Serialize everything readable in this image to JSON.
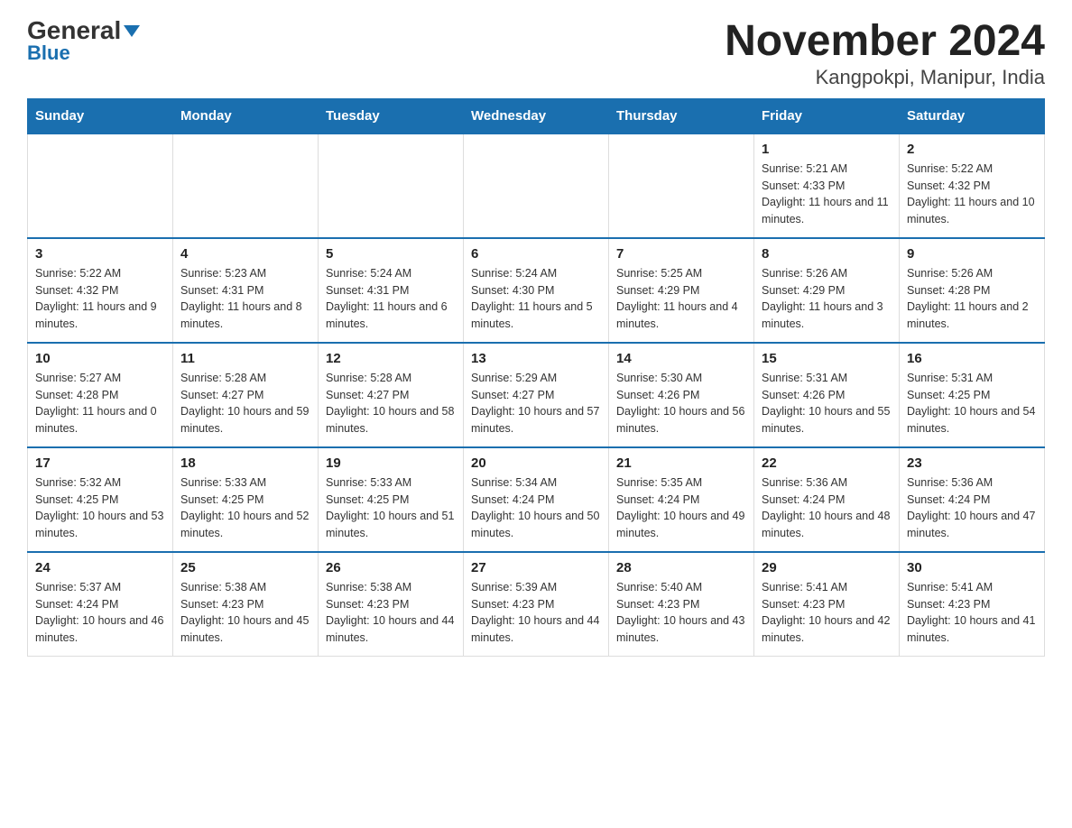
{
  "logo": {
    "general": "General",
    "triangle": "▲",
    "blue": "Blue"
  },
  "title": "November 2024",
  "subtitle": "Kangpokpi, Manipur, India",
  "days_of_week": [
    "Sunday",
    "Monday",
    "Tuesday",
    "Wednesday",
    "Thursday",
    "Friday",
    "Saturday"
  ],
  "weeks": [
    [
      {
        "day": "",
        "info": ""
      },
      {
        "day": "",
        "info": ""
      },
      {
        "day": "",
        "info": ""
      },
      {
        "day": "",
        "info": ""
      },
      {
        "day": "",
        "info": ""
      },
      {
        "day": "1",
        "info": "Sunrise: 5:21 AM\nSunset: 4:33 PM\nDaylight: 11 hours and 11 minutes."
      },
      {
        "day": "2",
        "info": "Sunrise: 5:22 AM\nSunset: 4:32 PM\nDaylight: 11 hours and 10 minutes."
      }
    ],
    [
      {
        "day": "3",
        "info": "Sunrise: 5:22 AM\nSunset: 4:32 PM\nDaylight: 11 hours and 9 minutes."
      },
      {
        "day": "4",
        "info": "Sunrise: 5:23 AM\nSunset: 4:31 PM\nDaylight: 11 hours and 8 minutes."
      },
      {
        "day": "5",
        "info": "Sunrise: 5:24 AM\nSunset: 4:31 PM\nDaylight: 11 hours and 6 minutes."
      },
      {
        "day": "6",
        "info": "Sunrise: 5:24 AM\nSunset: 4:30 PM\nDaylight: 11 hours and 5 minutes."
      },
      {
        "day": "7",
        "info": "Sunrise: 5:25 AM\nSunset: 4:29 PM\nDaylight: 11 hours and 4 minutes."
      },
      {
        "day": "8",
        "info": "Sunrise: 5:26 AM\nSunset: 4:29 PM\nDaylight: 11 hours and 3 minutes."
      },
      {
        "day": "9",
        "info": "Sunrise: 5:26 AM\nSunset: 4:28 PM\nDaylight: 11 hours and 2 minutes."
      }
    ],
    [
      {
        "day": "10",
        "info": "Sunrise: 5:27 AM\nSunset: 4:28 PM\nDaylight: 11 hours and 0 minutes."
      },
      {
        "day": "11",
        "info": "Sunrise: 5:28 AM\nSunset: 4:27 PM\nDaylight: 10 hours and 59 minutes."
      },
      {
        "day": "12",
        "info": "Sunrise: 5:28 AM\nSunset: 4:27 PM\nDaylight: 10 hours and 58 minutes."
      },
      {
        "day": "13",
        "info": "Sunrise: 5:29 AM\nSunset: 4:27 PM\nDaylight: 10 hours and 57 minutes."
      },
      {
        "day": "14",
        "info": "Sunrise: 5:30 AM\nSunset: 4:26 PM\nDaylight: 10 hours and 56 minutes."
      },
      {
        "day": "15",
        "info": "Sunrise: 5:31 AM\nSunset: 4:26 PM\nDaylight: 10 hours and 55 minutes."
      },
      {
        "day": "16",
        "info": "Sunrise: 5:31 AM\nSunset: 4:25 PM\nDaylight: 10 hours and 54 minutes."
      }
    ],
    [
      {
        "day": "17",
        "info": "Sunrise: 5:32 AM\nSunset: 4:25 PM\nDaylight: 10 hours and 53 minutes."
      },
      {
        "day": "18",
        "info": "Sunrise: 5:33 AM\nSunset: 4:25 PM\nDaylight: 10 hours and 52 minutes."
      },
      {
        "day": "19",
        "info": "Sunrise: 5:33 AM\nSunset: 4:25 PM\nDaylight: 10 hours and 51 minutes."
      },
      {
        "day": "20",
        "info": "Sunrise: 5:34 AM\nSunset: 4:24 PM\nDaylight: 10 hours and 50 minutes."
      },
      {
        "day": "21",
        "info": "Sunrise: 5:35 AM\nSunset: 4:24 PM\nDaylight: 10 hours and 49 minutes."
      },
      {
        "day": "22",
        "info": "Sunrise: 5:36 AM\nSunset: 4:24 PM\nDaylight: 10 hours and 48 minutes."
      },
      {
        "day": "23",
        "info": "Sunrise: 5:36 AM\nSunset: 4:24 PM\nDaylight: 10 hours and 47 minutes."
      }
    ],
    [
      {
        "day": "24",
        "info": "Sunrise: 5:37 AM\nSunset: 4:24 PM\nDaylight: 10 hours and 46 minutes."
      },
      {
        "day": "25",
        "info": "Sunrise: 5:38 AM\nSunset: 4:23 PM\nDaylight: 10 hours and 45 minutes."
      },
      {
        "day": "26",
        "info": "Sunrise: 5:38 AM\nSunset: 4:23 PM\nDaylight: 10 hours and 44 minutes."
      },
      {
        "day": "27",
        "info": "Sunrise: 5:39 AM\nSunset: 4:23 PM\nDaylight: 10 hours and 44 minutes."
      },
      {
        "day": "28",
        "info": "Sunrise: 5:40 AM\nSunset: 4:23 PM\nDaylight: 10 hours and 43 minutes."
      },
      {
        "day": "29",
        "info": "Sunrise: 5:41 AM\nSunset: 4:23 PM\nDaylight: 10 hours and 42 minutes."
      },
      {
        "day": "30",
        "info": "Sunrise: 5:41 AM\nSunset: 4:23 PM\nDaylight: 10 hours and 41 minutes."
      }
    ]
  ]
}
